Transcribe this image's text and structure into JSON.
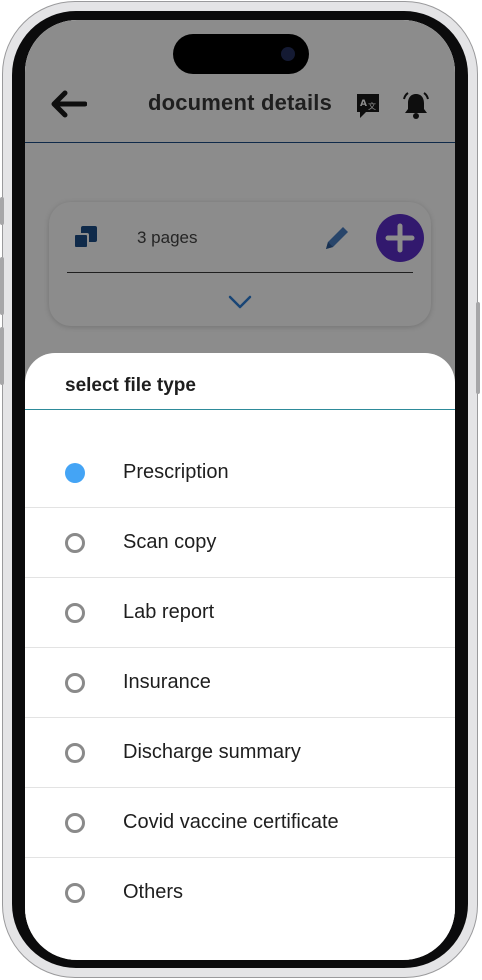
{
  "header": {
    "title": "document details",
    "back_icon": "back-arrow-icon",
    "translate_icon": "translate-icon",
    "notification_icon": "bell-icon"
  },
  "document_card": {
    "pages_label": "3 pages",
    "pages_icon": "copy-pages-icon",
    "edit_icon": "pencil-icon",
    "add_icon": "plus-icon",
    "expand_icon": "chevron-down-icon"
  },
  "file_type_sheet": {
    "title": "select file type",
    "selected_index": 0,
    "options": [
      {
        "label": "Prescription",
        "selected": true
      },
      {
        "label": "Scan copy",
        "selected": false
      },
      {
        "label": "Lab report",
        "selected": false
      },
      {
        "label": "Insurance",
        "selected": false
      },
      {
        "label": "Discharge summary",
        "selected": false
      },
      {
        "label": "Covid vaccine certificate",
        "selected": false
      },
      {
        "label": "Others",
        "selected": false
      }
    ]
  },
  "colors": {
    "accent_purple": "#5b2fc9",
    "radio_selected": "#44a4f5",
    "radio_unselected": "#8a8a8a",
    "icon_blue": "#1d4e87",
    "edit_blue": "#4a7fc1",
    "sheet_divider": "#2e8b9a"
  }
}
